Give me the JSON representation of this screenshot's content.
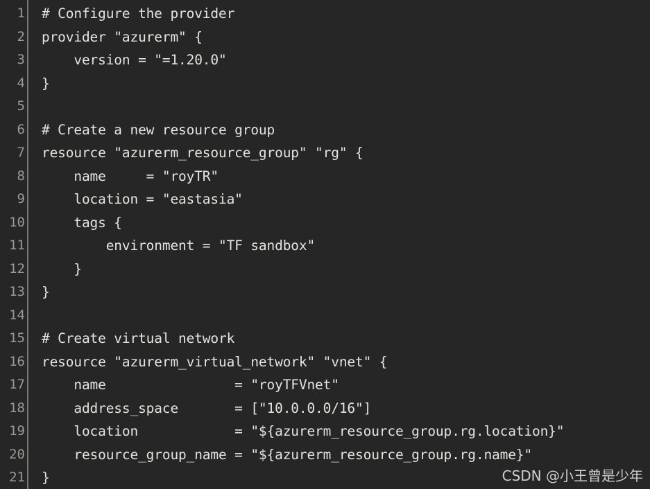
{
  "editor": {
    "language": "terraform",
    "theme": "dark",
    "background_color": "#262626",
    "text_color": "#e4e4de",
    "line_number_color": "#9b9b93",
    "gutter_rule_color": "#787878",
    "first_line_number": 1,
    "last_line_number": 21,
    "total_lines": 21,
    "lines": [
      {
        "number": "1",
        "text": "# Configure the provider"
      },
      {
        "number": "2",
        "text": "provider \"azurerm\" {"
      },
      {
        "number": "3",
        "text": "    version = \"=1.20.0\""
      },
      {
        "number": "4",
        "text": "}"
      },
      {
        "number": "5",
        "text": ""
      },
      {
        "number": "6",
        "text": "# Create a new resource group"
      },
      {
        "number": "7",
        "text": "resource \"azurerm_resource_group\" \"rg\" {"
      },
      {
        "number": "8",
        "text": "    name     = \"royTR\""
      },
      {
        "number": "9",
        "text": "    location = \"eastasia\""
      },
      {
        "number": "10",
        "text": "    tags {"
      },
      {
        "number": "11",
        "text": "        environment = \"TF sandbox\""
      },
      {
        "number": "12",
        "text": "    }"
      },
      {
        "number": "13",
        "text": "}"
      },
      {
        "number": "14",
        "text": ""
      },
      {
        "number": "15",
        "text": "# Create virtual network"
      },
      {
        "number": "16",
        "text": "resource \"azurerm_virtual_network\" \"vnet\" {"
      },
      {
        "number": "17",
        "text": "    name                = \"royTFVnet\""
      },
      {
        "number": "18",
        "text": "    address_space       = [\"10.0.0.0/16\"]"
      },
      {
        "number": "19",
        "text": "    location            = \"${azurerm_resource_group.rg.location}\""
      },
      {
        "number": "20",
        "text": "    resource_group_name = \"${azurerm_resource_group.rg.name}\""
      },
      {
        "number": "21",
        "text": "}"
      }
    ]
  },
  "watermark": {
    "text": "CSDN @小王曾是少年"
  }
}
